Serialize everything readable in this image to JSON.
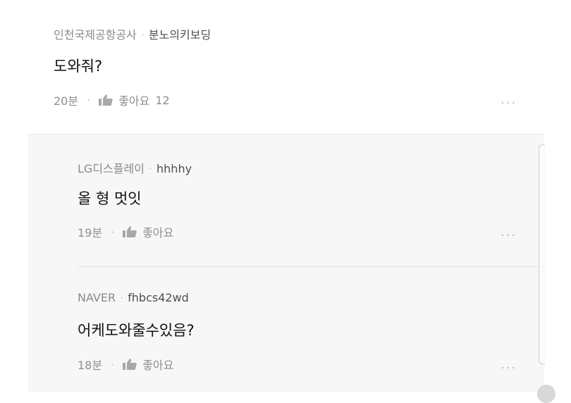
{
  "comments": [
    {
      "company": "인천국제공항공사",
      "nickname": "분노의키보딩",
      "text": "도와줘?",
      "time": "20분",
      "like_label": "좋아요",
      "like_count": "12"
    }
  ],
  "replies": [
    {
      "company": "LG디스플레이",
      "nickname": "hhhhy",
      "text": "올 형 멋잇",
      "time": "19분",
      "like_label": "좋아요"
    },
    {
      "company": "NAVER",
      "nickname": "fhbcs42wd",
      "text": "어케도와줄수있음?",
      "time": "18분",
      "like_label": "좋아요"
    }
  ],
  "ui": {
    "separator": "·",
    "more_label": "···",
    "thumb_icon": "thumbs-up-icon",
    "more_icon": "more-horizontal-icon"
  }
}
